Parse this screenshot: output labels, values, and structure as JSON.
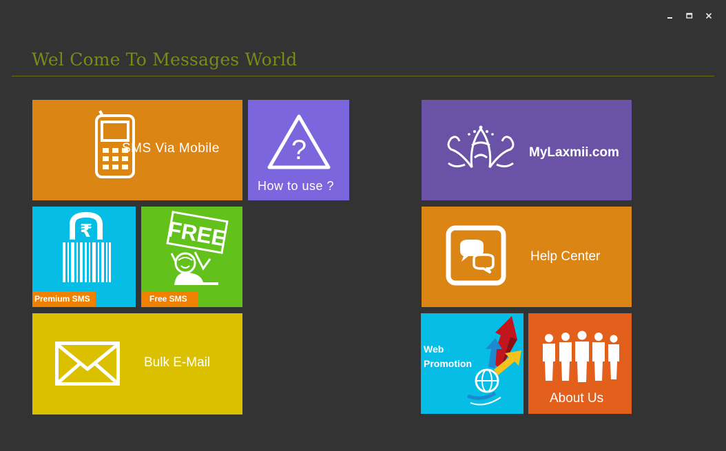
{
  "colors": {
    "background": "#333333",
    "title": "#7a8a1a",
    "divider": "#6d6f14",
    "orange": "#db8515",
    "purple_light": "#7b66dd",
    "purple": "#6a52a6",
    "cyan": "#06bde6",
    "green": "#62c21b",
    "yellow": "#dbc000",
    "red_orange": "#e35f1c",
    "tag_orange": "#ee8200"
  },
  "window": {
    "minimize_icon": "minimize-icon",
    "maximize_icon": "maximize-icon",
    "close_icon": "close-icon"
  },
  "header": {
    "title": "Wel Come To Messages World"
  },
  "tiles": {
    "sms_via_mobile": {
      "label": "SMS Via Mobile",
      "icon": "mobile-phone-icon"
    },
    "how_to_use": {
      "label": "How to use ?",
      "icon": "question-triangle-icon"
    },
    "premium_sms": {
      "label": "Premium SMS",
      "icon": "rupee-lock-barcode-icon"
    },
    "free_sms": {
      "label": "Free SMS",
      "icon": "free-sign-icon"
    },
    "bulk_email": {
      "label": "Bulk E-Mail",
      "icon": "envelope-icon"
    },
    "mylaxmii": {
      "label": "MyLaxmii.com",
      "icon": "mylaxmii-logo-icon"
    },
    "help_center": {
      "label": "Help Center",
      "icon": "chat-bubbles-icon"
    },
    "web_promotion": {
      "label_line1": "Web",
      "label_line2": "Promotion",
      "icon": "globe-arrows-icon"
    },
    "about_us": {
      "label": "About Us",
      "icon": "people-group-icon"
    }
  }
}
